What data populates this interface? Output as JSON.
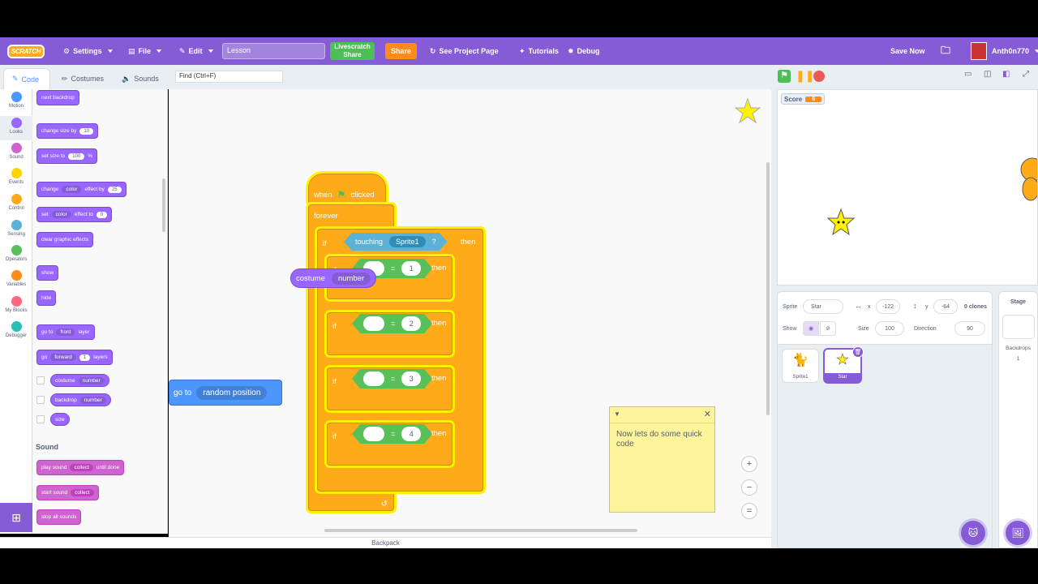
{
  "menubar": {
    "logo": "SCRATCH",
    "settings": "Settings",
    "file": "File",
    "edit": "Edit",
    "project_title": "Lesson",
    "livescratch": "Livescratch Share",
    "share": "Share",
    "see_project": "See Project Page",
    "tutorials": "Tutorials",
    "debug": "Debug",
    "save_now": "Save Now",
    "username": "Anth0n770"
  },
  "tabs": {
    "code": "Code",
    "costumes": "Costumes",
    "sounds": "Sounds"
  },
  "find_placeholder": "Find (Ctrl+F)",
  "categories": [
    {
      "label": "Motion",
      "color": "#4c97ff"
    },
    {
      "label": "Looks",
      "color": "#9966ff"
    },
    {
      "label": "Sound",
      "color": "#cf63cf"
    },
    {
      "label": "Events",
      "color": "#ffd500"
    },
    {
      "label": "Control",
      "color": "#ffab19"
    },
    {
      "label": "Sensing",
      "color": "#5cb1d6"
    },
    {
      "label": "Operators",
      "color": "#59c059"
    },
    {
      "label": "Variables",
      "color": "#ff8c1a"
    },
    {
      "label": "My Blocks",
      "color": "#ff6680"
    },
    {
      "label": "Debugger",
      "color": "#29beb8"
    }
  ],
  "palette": {
    "next_backdrop": "next backdrop",
    "change_size_by": "change size by",
    "change_size_val": "10",
    "set_size_to": "set size to",
    "set_size_val": "100",
    "set_size_unit": "%",
    "change": "change",
    "color": "color",
    "effect_by": "effect by",
    "effect_by_val": "25",
    "set": "set",
    "effect_to": "effect to",
    "effect_to_val": "0",
    "clear_effects": "clear graphic effects",
    "show": "show",
    "hide": "hide",
    "go_to": "go to",
    "front": "front",
    "layer": "layer",
    "go": "go",
    "forward": "forward",
    "layers_val": "1",
    "layers": "layers",
    "costume": "costume",
    "number": "number",
    "backdrop": "backdrop",
    "size": "size",
    "sound_heading": "Sound",
    "play_sound": "play sound",
    "collect": "collect",
    "until_done": "until done",
    "start_sound": "start sound",
    "stop_all_sounds": "stop all sounds"
  },
  "script": {
    "when": "when",
    "clicked": "clicked",
    "forever": "forever",
    "if": "if",
    "then": "then",
    "touching": "touching",
    "sprite1": "Sprite1",
    "question": "?",
    "equals": "=",
    "vals": [
      "1",
      "2",
      "3",
      "4"
    ],
    "dragging_costume": "costume",
    "dragging_number": "number",
    "go_to": "go to",
    "random_position": "random position"
  },
  "note": {
    "text": "Now lets do some quick code"
  },
  "backpack": "Backpack",
  "stage": {
    "score_label": "Score",
    "score_value": "6"
  },
  "sprite_info": {
    "sprite_label": "Sprite",
    "sprite_name": "Star",
    "x_label": "x",
    "x_val": "-122",
    "y_label": "y",
    "y_val": "-64",
    "clones": "0 clones",
    "show_label": "Show",
    "size_label": "Size",
    "size_val": "100",
    "direction_label": "Direction",
    "direction_val": "90"
  },
  "sprites": [
    {
      "name": "Sprite1"
    },
    {
      "name": "Star"
    }
  ],
  "stage_panel": {
    "title": "Stage",
    "backdrops_label": "Backdrops",
    "backdrops_count": "1"
  }
}
